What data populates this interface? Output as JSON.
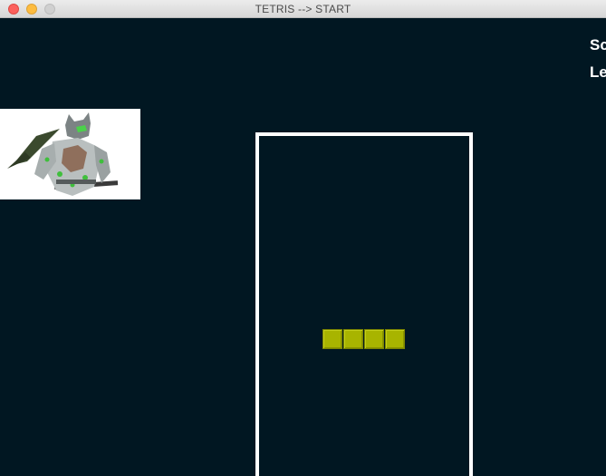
{
  "window": {
    "title": "TETRIS --> START"
  },
  "stats": {
    "score_label": "Sc",
    "level_label": "Le"
  },
  "portrait": {
    "subject": "armored-ninja-character-portrait"
  },
  "active_piece": {
    "type": "I",
    "orientation": "horizontal",
    "cells": 4,
    "color": "#a8b400"
  },
  "colors": {
    "background": "#011722",
    "board_border": "#ffffff",
    "piece": "#a8b400"
  }
}
